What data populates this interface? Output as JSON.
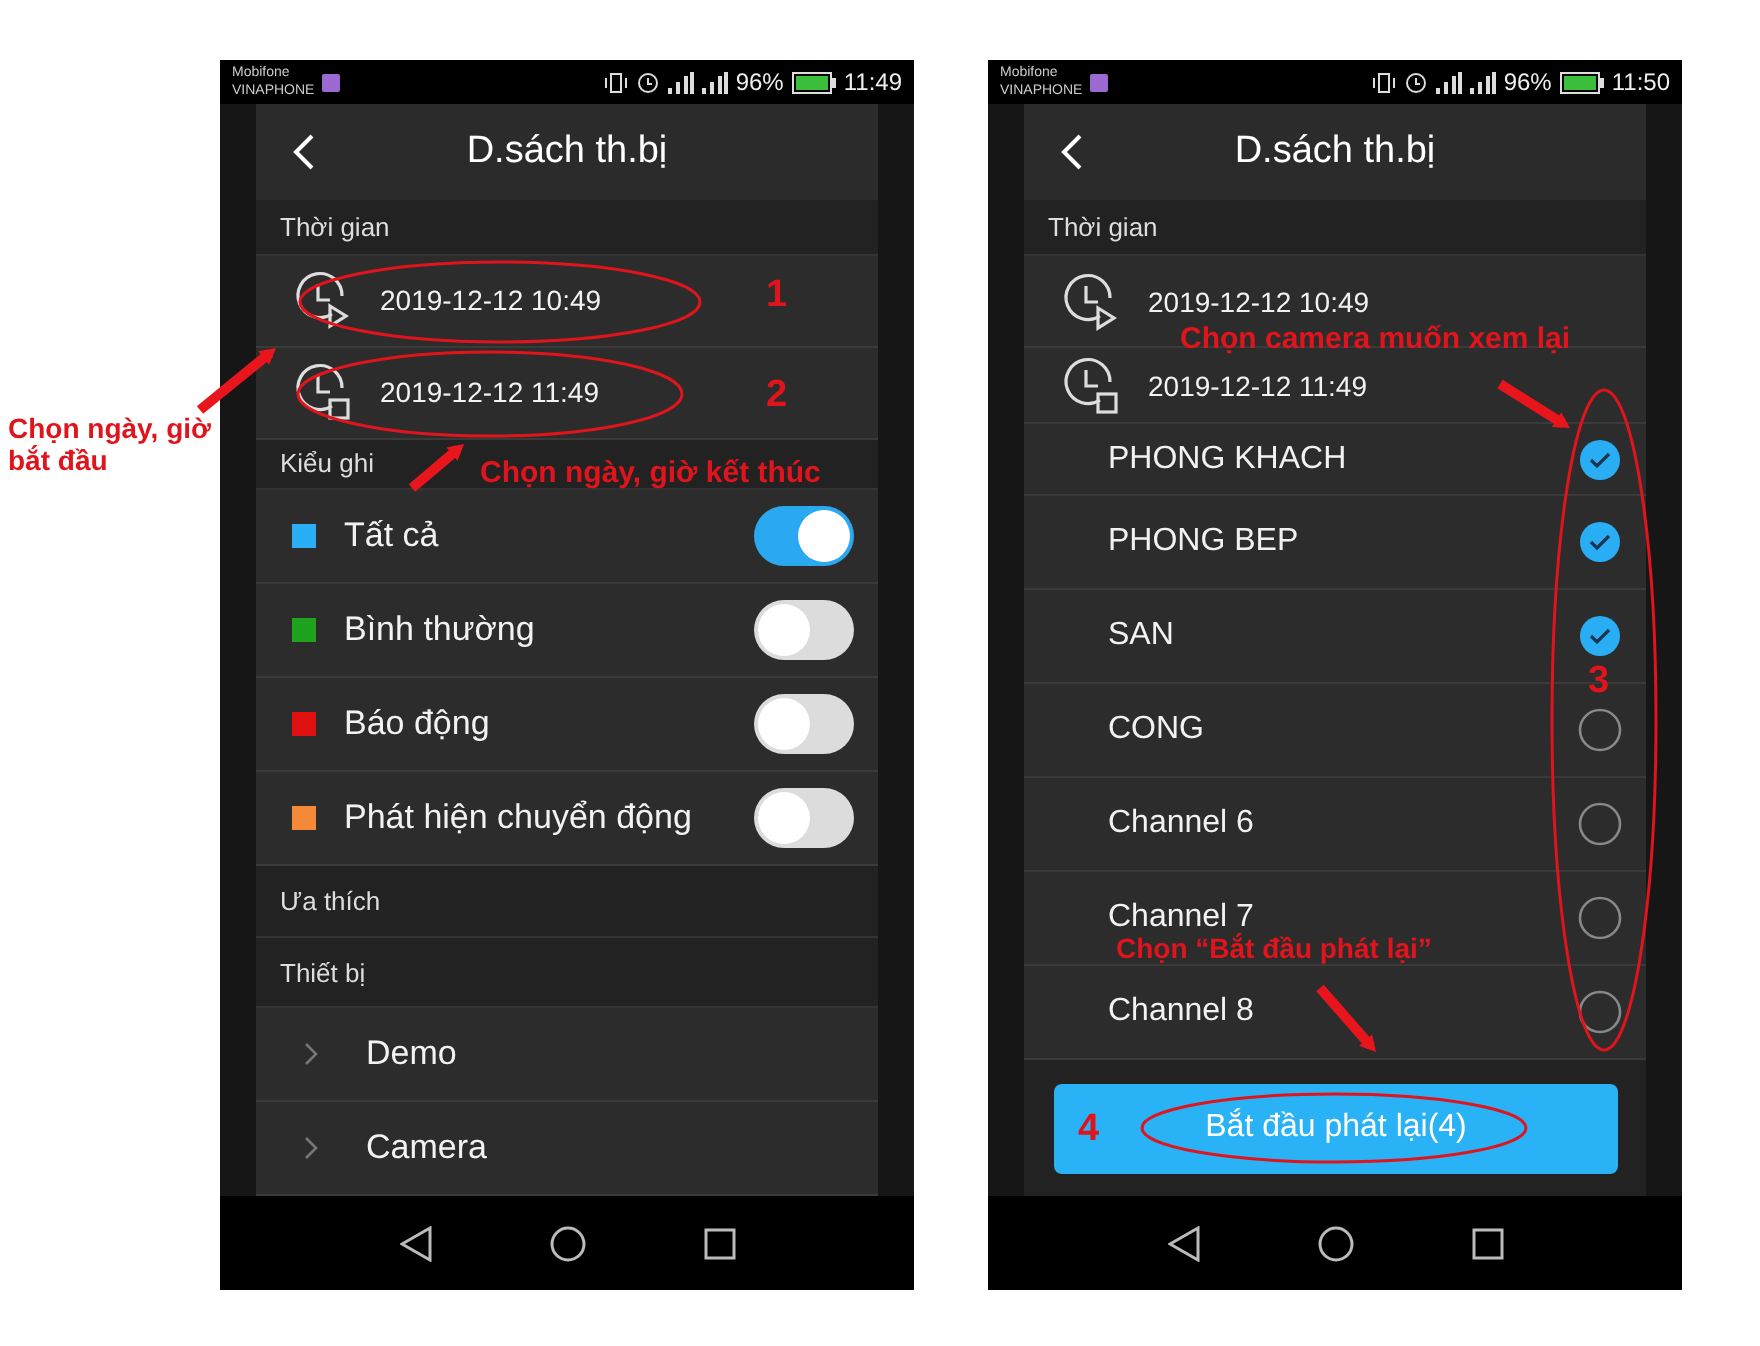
{
  "screens": [
    {
      "kind": "filter",
      "status_bar": {
        "carrier_top": "Mobifone",
        "carrier_bottom": "VINAPHONE",
        "battery": "96%",
        "time": "11:49"
      },
      "title": "D.sách th.bị",
      "time_section": "Thời gian",
      "times": [
        {
          "kind": "start",
          "value": "2019-12-12 10:49"
        },
        {
          "kind": "end",
          "value": "2019-12-12 11:49"
        }
      ],
      "record_section": "Kiểu ghi",
      "record_types": [
        {
          "label": "Tất cả",
          "color": "#29aef5",
          "on": true
        },
        {
          "label": "Bình thường",
          "color": "#1fa31f",
          "on": false
        },
        {
          "label": "Báo động",
          "color": "#e01010",
          "on": false
        },
        {
          "label": "Phát hiện chuyển động",
          "color": "#f5893a",
          "on": false
        }
      ],
      "favorites_section": "Ưa thích",
      "devices_section": "Thiết bị",
      "devices": [
        {
          "name": "Demo"
        },
        {
          "name": "Camera"
        }
      ]
    },
    {
      "kind": "channels",
      "status_bar": {
        "carrier_top": "Mobifone",
        "carrier_bottom": "VINAPHONE",
        "battery": "96%",
        "time": "11:50"
      },
      "title": "D.sách th.bị",
      "time_section": "Thời gian",
      "times": [
        {
          "kind": "start",
          "value": "2019-12-12 10:49"
        },
        {
          "kind": "end",
          "value": "2019-12-12 11:49"
        }
      ],
      "channels": [
        {
          "name": "PHONG KHACH",
          "checked": true
        },
        {
          "name": "PHONG BEP",
          "checked": true
        },
        {
          "name": "SAN",
          "checked": true
        },
        {
          "name": "CONG",
          "checked": false
        },
        {
          "name": "Channel 6",
          "checked": false
        },
        {
          "name": "Channel 7",
          "checked": false
        },
        {
          "name": "Channel 8",
          "checked": false
        }
      ],
      "play_button": "Bắt đầu phát lại(4)"
    }
  ],
  "annotations": [
    {
      "text": "Chọn ngày, giờ bắt đầu"
    },
    {
      "text": "Chọn ngày, giờ kết thúc"
    },
    {
      "text": "Chọn camera muốn xem lại"
    },
    {
      "text": "Chọn “Bắt đầu phát lại”"
    }
  ],
  "step_numbers": [
    "1",
    "2",
    "3",
    "4"
  ]
}
